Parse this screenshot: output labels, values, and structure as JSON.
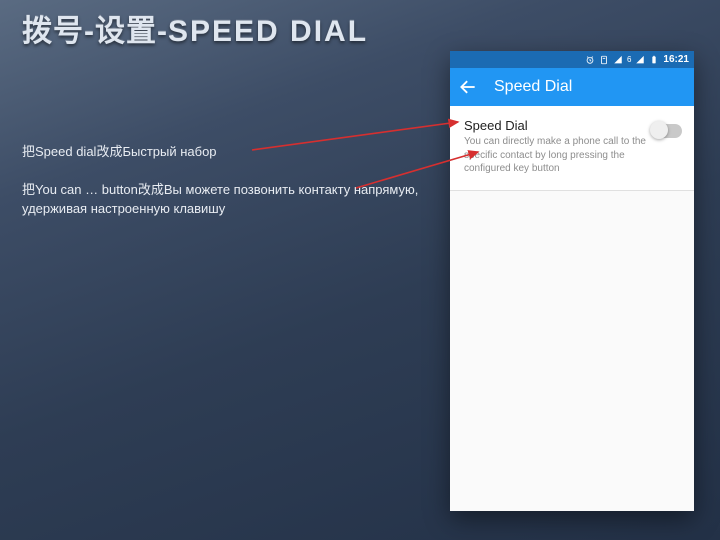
{
  "slide": {
    "title_prefix": "拨号-设置-",
    "title_latin": "SPEED DIAL"
  },
  "instructions": {
    "line1": "把Speed dial改成Быстрый набор",
    "line2": "把You can … button改成Вы можете позвонить контакту напрямую, удерживая настроенную клавишу"
  },
  "phone": {
    "status": {
      "time": "16:21",
      "signal_label": "6"
    },
    "appbar": {
      "title": "Speed Dial"
    },
    "pref": {
      "title": "Speed Dial",
      "subtitle": "You can directly make a phone call to the specific contact by long pressing the configured key button",
      "toggle_on": false
    }
  }
}
